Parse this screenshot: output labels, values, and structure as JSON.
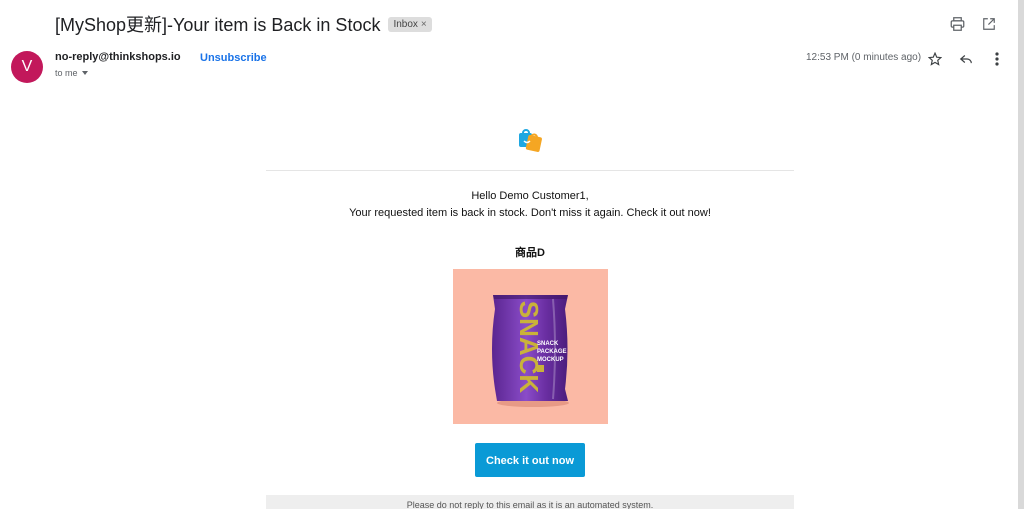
{
  "email": {
    "subject": "[MyShop更新]-Your item is Back in Stock",
    "label": "Inbox",
    "label_close": "×",
    "sender_initial": "V",
    "sender": "no-reply@thinkshops.io",
    "unsubscribe": "Unsubscribe",
    "to_me": "to me",
    "timestamp": "12:53 PM (0 minutes ago)"
  },
  "icons": {
    "print": "print-icon",
    "open_new": "open-in-new-icon",
    "star": "star-icon",
    "reply": "reply-icon",
    "more": "more-vert-icon",
    "shop_logo": "shopping-bag-logo"
  },
  "body": {
    "greeting_line1": "Hello Demo Customer1,",
    "greeting_line2": "Your requested item is back in stock. Don't miss it again. Check it out now!",
    "product_name": "商品D",
    "cta_label": "Check it out now",
    "footer_text": "Please do not reply to this email as it is an automated system."
  },
  "colors": {
    "avatar": "#c2185b",
    "link": "#1a73e8",
    "cta": "#0a9ad6",
    "product_bg": "#fbb9a5",
    "package": "#6b2fa3"
  }
}
